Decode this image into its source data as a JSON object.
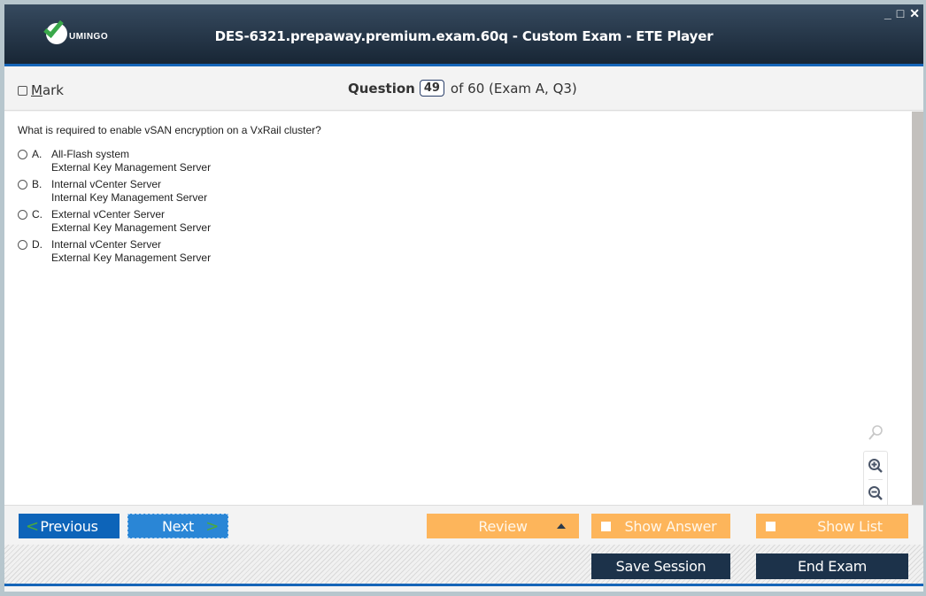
{
  "window": {
    "title": "DES-6321.prepaway.premium.exam.60q - Custom Exam - ETE Player",
    "logo_text": "UMINGO",
    "controls": {
      "minimize": "_",
      "maximize": "□",
      "close": "✕"
    }
  },
  "question_bar": {
    "mark_label_prefix": "M",
    "mark_label_rest": "ark",
    "question_word": "Question",
    "question_number": "49",
    "question_suffix": "of 60 (Exam A, Q3)"
  },
  "question": {
    "text": "What is required to enable vSAN encryption on a VxRail cluster?",
    "options": [
      {
        "letter": "A.",
        "lines": [
          "All-Flash system",
          "External Key Management Server"
        ]
      },
      {
        "letter": "B.",
        "lines": [
          "Internal vCenter Server",
          "Internal Key Management Server"
        ]
      },
      {
        "letter": "C.",
        "lines": [
          "External vCenter Server",
          "External Key Management Server"
        ]
      },
      {
        "letter": "D.",
        "lines": [
          "Internal vCenter Server",
          "External Key Management Server"
        ]
      }
    ]
  },
  "zoom": {
    "search_icon": "search-icon",
    "zoom_in_icon": "zoom-in-icon",
    "zoom_out_icon": "zoom-out-icon"
  },
  "nav": {
    "previous": "Previous",
    "next": "Next",
    "review": "Review",
    "show_answer": "Show Answer",
    "show_list": "Show List"
  },
  "footer": {
    "save_session": "Save Session",
    "end_exam": "End Exam"
  },
  "colors": {
    "accent_blue": "#1565b8",
    "orange": "#fdb55b",
    "dark_navy": "#1c324a",
    "check_green": "#3aa84a"
  }
}
